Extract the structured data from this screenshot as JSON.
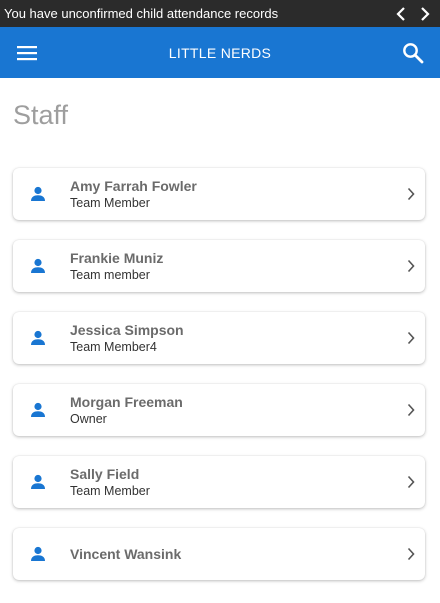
{
  "notification": {
    "text": "You have unconfirmed child attendance records",
    "prev_icon": "chevron-left-icon",
    "next_icon": "chevron-right-icon"
  },
  "app_bar": {
    "title": "LITTLE NERDS",
    "menu_icon": "hamburger-menu-icon",
    "search_icon": "search-icon",
    "background": "#1976d2"
  },
  "page": {
    "title": "Staff"
  },
  "staff": [
    {
      "name": "Amy Farrah Fowler",
      "role": "Team Member"
    },
    {
      "name": "Frankie Muniz",
      "role": "Team member"
    },
    {
      "name": "Jessica Simpson",
      "role": "Team Member4"
    },
    {
      "name": "Morgan Freeman",
      "role": "Owner"
    },
    {
      "name": "Sally Field",
      "role": "Team Member"
    },
    {
      "name": "Vincent Wansink",
      "role": ""
    }
  ],
  "colors": {
    "accent": "#1976d2",
    "notification_bg": "#2b2b2b"
  }
}
